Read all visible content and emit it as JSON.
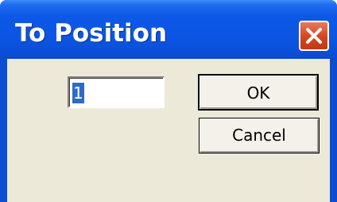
{
  "window": {
    "title": "To Position"
  },
  "position_field": {
    "value": "1"
  },
  "buttons": {
    "ok_label": "OK",
    "cancel_label": "Cancel"
  },
  "icons": {
    "close": "close-icon"
  },
  "colors": {
    "titlebar": "#0b55e2",
    "client_background": "#ece9d8",
    "close_button": "#d4451e",
    "selection": "#316ac5"
  }
}
